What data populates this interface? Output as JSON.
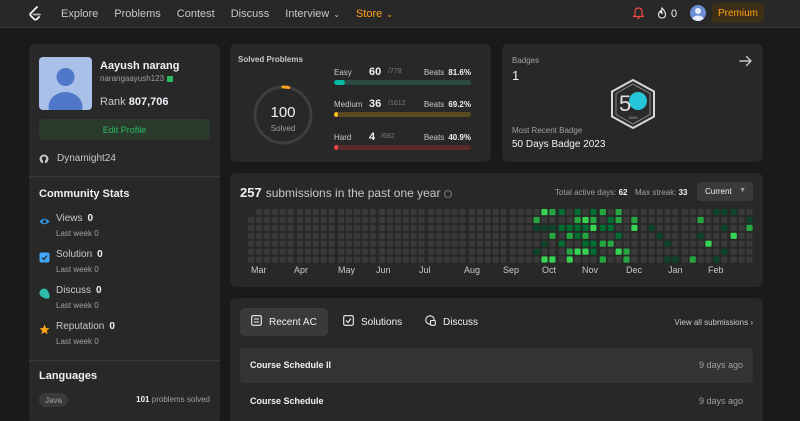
{
  "nav": {
    "items": [
      {
        "label": "Explore",
        "caret": false
      },
      {
        "label": "Problems",
        "caret": false
      },
      {
        "label": "Contest",
        "caret": false
      },
      {
        "label": "Discuss",
        "caret": false
      },
      {
        "label": "Interview",
        "caret": true
      },
      {
        "label": "Store",
        "caret": true
      }
    ],
    "streak_count": "0",
    "premium_label": "Premium",
    "accent": "#ffa116"
  },
  "profile": {
    "name": "Aayush narang",
    "username": "narangaayush123",
    "rank_label": "Rank",
    "rank_value": "807,706",
    "edit_label": "Edit Profile",
    "github": "Dynamight24"
  },
  "community": {
    "title": "Community Stats",
    "stats": [
      {
        "label": "Views",
        "value": "0",
        "sub": "Last week 0",
        "icon": "eye-icon",
        "color": "#2e9bf0"
      },
      {
        "label": "Solution",
        "value": "0",
        "sub": "Last week 0",
        "icon": "solution-check-icon",
        "color": "#40a9ff"
      },
      {
        "label": "Discuss",
        "value": "0",
        "sub": "Last week 0",
        "icon": "chat-icon",
        "color": "#2cbbab"
      },
      {
        "label": "Reputation",
        "value": "0",
        "sub": "Last week 0",
        "icon": "star-icon",
        "color": "#ffa116"
      }
    ]
  },
  "languages": {
    "title": "Languages",
    "items": [
      {
        "name": "Java",
        "count": "101",
        "suffix": "problems solved"
      }
    ]
  },
  "solved": {
    "title": "Solved Problems",
    "total": "100",
    "total_label": "Solved",
    "difficulties": [
      {
        "name": "Easy",
        "count": "60",
        "total": "/778",
        "beats_label": "Beats",
        "beats": "81.6%",
        "fraction": 0.077,
        "color": "#00b8a3",
        "track": "#2a4a42"
      },
      {
        "name": "Medium",
        "count": "36",
        "total": "/1612",
        "beats_label": "Beats",
        "beats": "69.2%",
        "fraction": 0.022,
        "color": "#ffc01e",
        "track": "#5a4a22"
      },
      {
        "name": "Hard",
        "count": "4",
        "total": "/682",
        "beats_label": "Beats",
        "beats": "40.9%",
        "fraction": 0.006,
        "color": "#ef4743",
        "track": "#5a2a2a"
      }
    ]
  },
  "badges": {
    "title": "Badges",
    "count": "1",
    "recent_label": "Most Recent Badge",
    "recent_name": "50 Days Badge 2023",
    "badge_glyph": "5",
    "badge_sub": "2023"
  },
  "heatmap": {
    "count": "257",
    "title_rest": "submissions in the past one year",
    "active_label": "Total active days:",
    "active_value": "62",
    "streak_label": "Max streak:",
    "streak_value": "33",
    "select_value": "Current",
    "months": [
      "Mar",
      "Apr",
      "May",
      "Jun",
      "Jul",
      "Aug",
      "Sep",
      "Oct",
      "Nov",
      "Dec",
      "Jan",
      "Feb"
    ]
  },
  "recent": {
    "tabs": [
      {
        "label": "Recent AC",
        "icon": "list-icon",
        "active": true
      },
      {
        "label": "Solutions",
        "icon": "solution-icon",
        "active": false
      },
      {
        "label": "Discuss",
        "icon": "discuss-icon",
        "active": false
      }
    ],
    "view_all": "View all submissions",
    "rows": [
      {
        "title": "Course Schedule II",
        "date": "9 days ago"
      },
      {
        "title": "Course Schedule",
        "date": "9 days ago"
      }
    ]
  }
}
